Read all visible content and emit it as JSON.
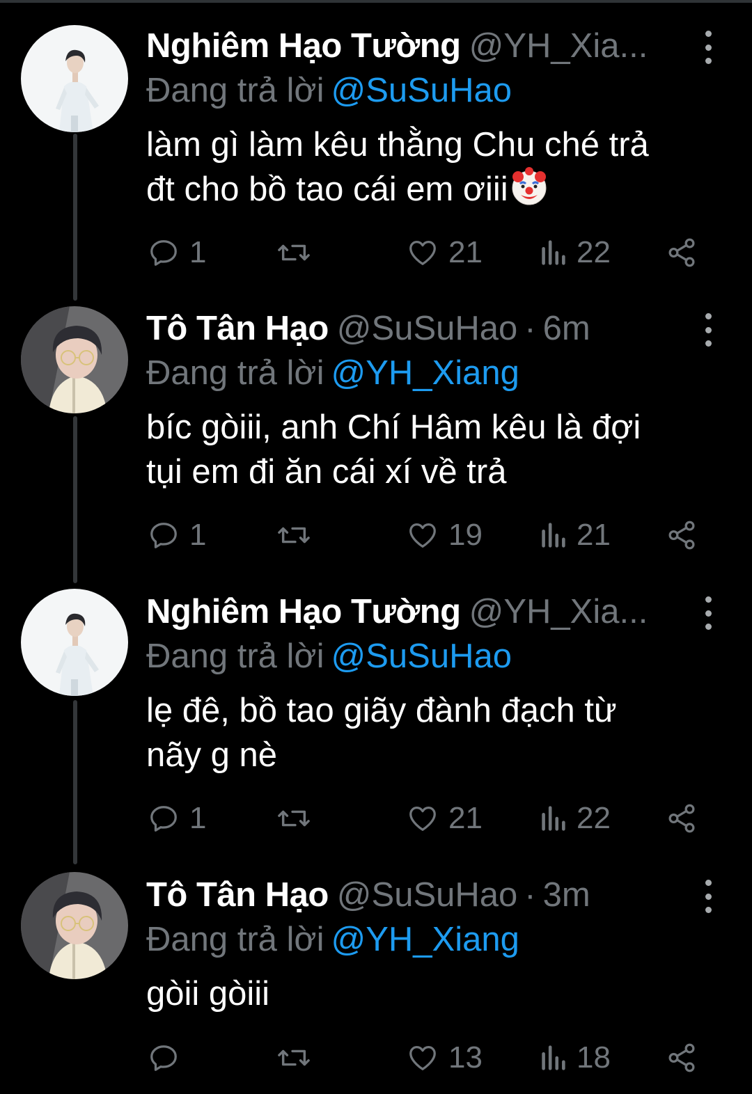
{
  "colors": {
    "background": "#000000",
    "name": "#ffffff",
    "muted": "#71767b",
    "link": "#1d9bf0",
    "thread_line": "#333639"
  },
  "tweets": [
    {
      "name": "Nghiêm Hạo Tường",
      "handle": "@YH_Xia...",
      "dot": "",
      "time": "",
      "reply_label": "Đang trả lời",
      "reply_to": "@SuSuHao",
      "lines": [
        "làm gì làm kêu thằng Chu ché trả",
        "đt cho bồ tao cái em ơiii"
      ],
      "emoji": "clown-face",
      "replies": "1",
      "retweets": "",
      "likes": "21",
      "views": "22"
    },
    {
      "name": "Tô Tân Hạo",
      "handle": "@SuSuHao",
      "dot": "·",
      "time": "6m",
      "reply_label": "Đang trả lời",
      "reply_to": "@YH_Xiang",
      "lines": [
        "bíc gòiii, anh Chí Hâm kêu là đợi",
        "tụi em đi ăn cái xí về trả"
      ],
      "emoji": "",
      "replies": "1",
      "retweets": "",
      "likes": "19",
      "views": "21"
    },
    {
      "name": "Nghiêm Hạo Tường",
      "handle": "@YH_Xia...",
      "dot": "",
      "time": "",
      "reply_label": "Đang trả lời",
      "reply_to": "@SuSuHao",
      "lines": [
        "lẹ đê, bồ tao giãy đành đạch từ",
        "nãy g nè"
      ],
      "emoji": "",
      "replies": "1",
      "retweets": "",
      "likes": "21",
      "views": "22"
    },
    {
      "name": "Tô Tân Hạo",
      "handle": "@SuSuHao",
      "dot": "·",
      "time": "3m",
      "reply_label": "Đang trả lời",
      "reply_to": "@YH_Xiang",
      "lines": [
        "gòii gòiii"
      ],
      "emoji": "",
      "replies": "",
      "retweets": "",
      "likes": "13",
      "views": "18"
    }
  ]
}
